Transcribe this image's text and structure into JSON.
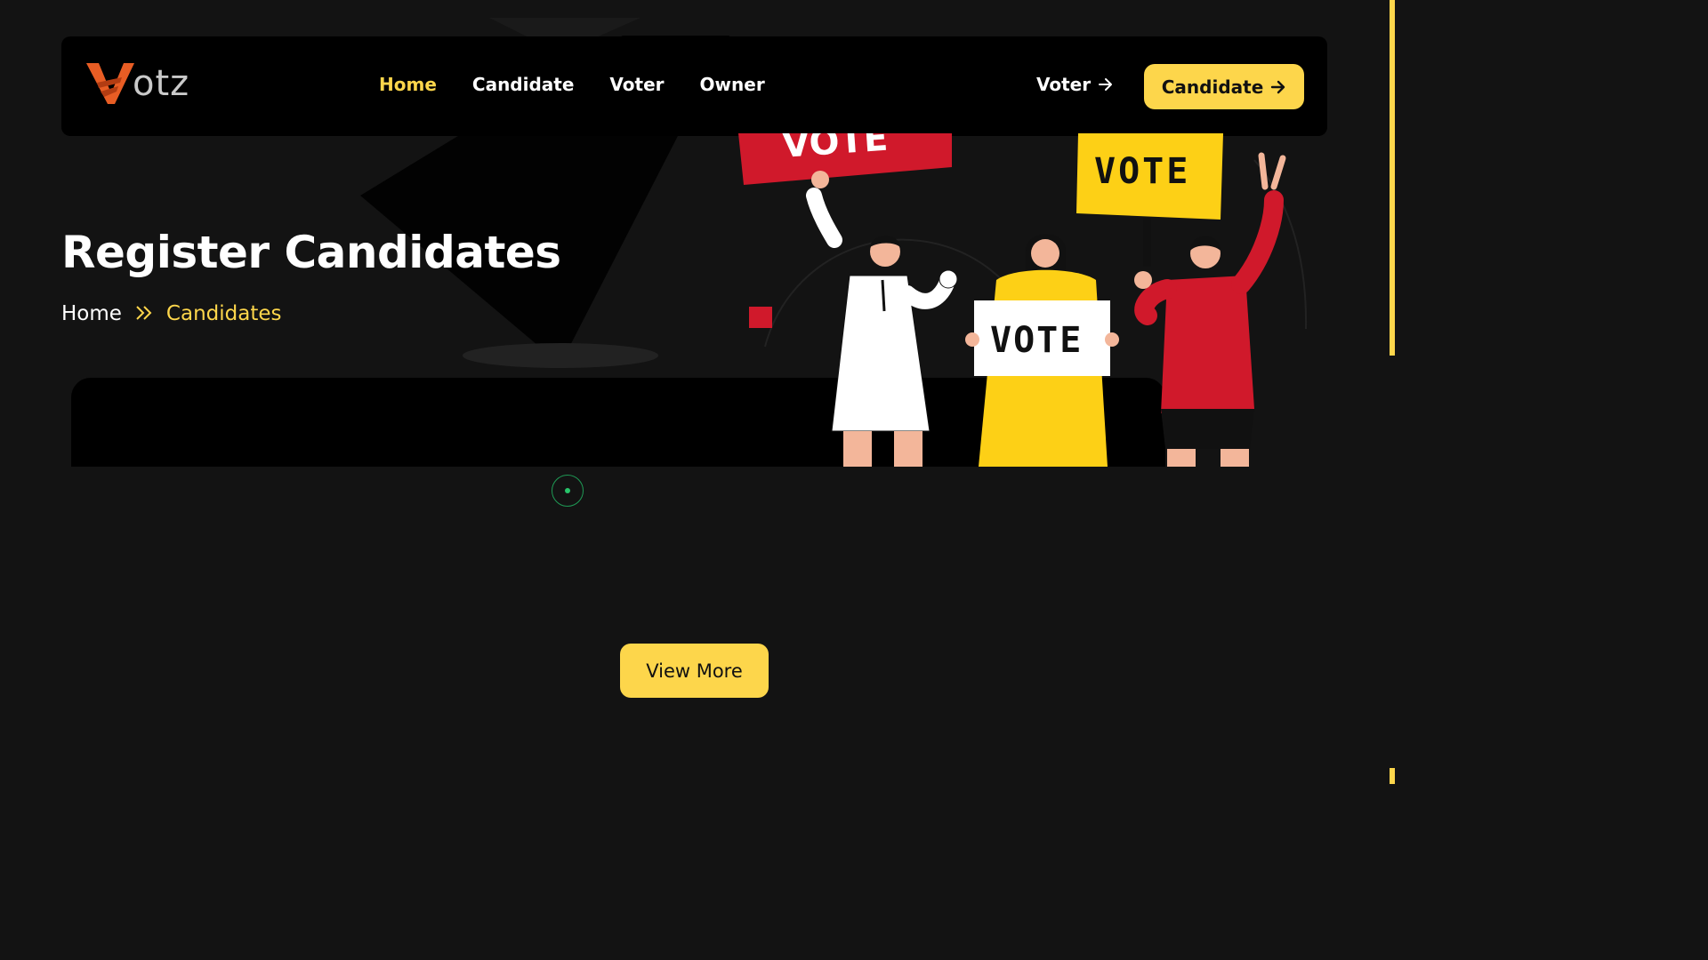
{
  "brand": {
    "logo_text": "otz"
  },
  "nav": {
    "items": [
      {
        "label": "Home",
        "active": true
      },
      {
        "label": "Candidate",
        "active": false
      },
      {
        "label": "Voter",
        "active": false
      },
      {
        "label": "Owner",
        "active": false
      }
    ],
    "voter_link": "Voter",
    "candidate_button": "Candidate"
  },
  "hero": {
    "title": "Register Candidates",
    "breadcrumb": {
      "home": "Home",
      "current": "Candidates"
    },
    "signs": {
      "red": "VOTE",
      "yellow": "VOTE",
      "white": "VOTE"
    }
  },
  "actions": {
    "view_more": "View More"
  },
  "colors": {
    "accent": "#fdd64b",
    "background": "#131313",
    "navbar": "#000000",
    "red": "#d0192b",
    "loader": "#1f9a55"
  }
}
